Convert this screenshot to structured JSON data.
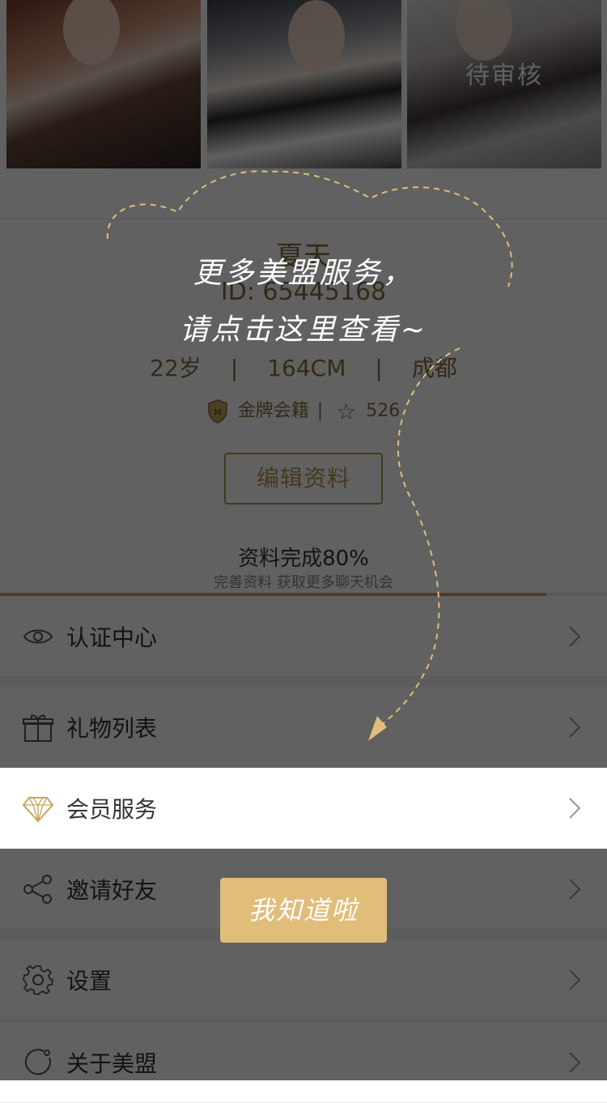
{
  "photos": {
    "pending_label": "待审核"
  },
  "profile": {
    "nickname": "夏天",
    "id_text": "ID: 65445168",
    "age": "22岁",
    "height": "164CM",
    "city": "成都",
    "stat_separator": "|",
    "membership": "金牌会籍",
    "badge_separator": "|",
    "favorites": "526",
    "edit_button": "编辑资料",
    "completion_text": "资料完成80%",
    "completion_hint": "完善资料 获取更多聊天机会",
    "completion_progress": 0.9
  },
  "menu": {
    "items": [
      {
        "label": "认证中心",
        "icon": "eye-icon"
      },
      {
        "label": "礼物列表",
        "icon": "gift-icon"
      },
      {
        "label": "会员服务",
        "icon": "diamond-icon"
      },
      {
        "label": "邀请好友",
        "icon": "share-icon"
      },
      {
        "label": "设置",
        "icon": "gear-icon"
      },
      {
        "label": "关于美盟",
        "icon": "about-icon"
      }
    ]
  },
  "tip": {
    "line1": "更多美盟服务，",
    "line2": "请点击这里查看~",
    "confirm_button": "我知道啦"
  },
  "colors": {
    "accent": "#c9a45a",
    "button": "#e0bd79",
    "overlay": "rgba(0,0,0,0.62)"
  }
}
